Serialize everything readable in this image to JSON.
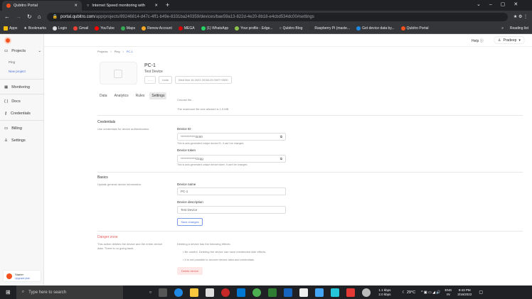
{
  "browser": {
    "tabs": [
      {
        "title": "Qubitro Portal",
        "active": true
      },
      {
        "title": "Internet Speed monitoring with",
        "active": false
      }
    ],
    "url_host": "portal.qubitro.com",
    "url_path": "/app/projects/89246814-d47c-4ff1-b49e-8331ba240359/devices/bae59a13-822d-4e20-8b18-e4cbd534dc00#settings",
    "bookmarks": [
      "Apps",
      "Bookmarks",
      "Login",
      "Gmail",
      "YouTube",
      "Maps",
      "Renew Account",
      "MEGA",
      "(1) WhatsApp",
      "Your profile - Edge...",
      "Qubitro Blog",
      "Raspberry Pi (maste...",
      "Get device data by...",
      "Qubitro Portal"
    ],
    "reading_list": "Reading list"
  },
  "sidebar": {
    "projects": "Projects",
    "project_items": [
      "Ping"
    ],
    "new_project": "New project",
    "items": [
      "Monitoring",
      "Docs",
      "Credentials",
      "Billing",
      "Settings"
    ],
    "plan": "Starter",
    "upgrade": "Upgrade plan"
  },
  "header": {
    "help": "Help",
    "user": "Pradeep"
  },
  "breadcrumb": [
    "Projects",
    "Ping",
    "PC-1"
  ],
  "device": {
    "name": "PC-1",
    "description": "Test Device",
    "tag1": "- - -",
    "tag2": "India",
    "created": "Wed Mar 16 2022 20:58:23 GMT+0530"
  },
  "tabs": [
    "Data",
    "Analytics",
    "Rules",
    "Settings"
  ],
  "image": {
    "choose": "Choose file...",
    "max_size": "The maximum file size allowed is 1.5 MB"
  },
  "credentials": {
    "title": "Credentials",
    "desc": "Use credentials for device authentication.",
    "id_label": "Device ID",
    "id_value": "************dc00",
    "id_help": "This is auto-generated unique device ID. It can't be changed.",
    "token_label": "Device token",
    "token_value": "************Ozqg",
    "token_help": "This is auto-generated unique device token. It can't be changed."
  },
  "basics": {
    "title": "Basics",
    "desc": "Update general device information.",
    "name_label": "Device name",
    "name_value": "PC-1",
    "desc_label": "Device description",
    "desc_value": "Test Device",
    "save": "Save changes"
  },
  "danger": {
    "title": "Danger zone",
    "desc": "This action deletes the device and the entire device data. There is no going back.",
    "effects": "Deleting a device has the following effects:",
    "bullets": [
      "Be careful. Deleting the device can have unintended side effects.",
      "It is not possible to recover device data and credentials."
    ],
    "delete": "Delete device"
  },
  "taskbar": {
    "search": "Type here to search",
    "net_up": "1.1 kbps",
    "net_down": "2.0 kbps",
    "temp": "29°C",
    "lang1": "ENG",
    "lang2": "IN",
    "time": "9:43 PM",
    "date": "3/16/2022"
  }
}
